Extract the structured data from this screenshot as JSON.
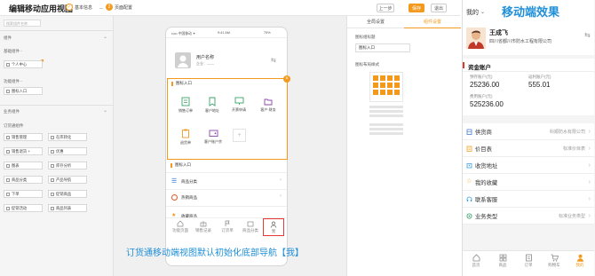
{
  "header": {
    "title": "编辑移动应用视图",
    "steps": [
      {
        "num": "✓",
        "label": "基本信息",
        "color": "#f39a1e"
      },
      {
        "num": "2",
        "label": "页面配置",
        "color": "#f39a1e"
      }
    ],
    "buttons": {
      "prev": "上一步",
      "save": "保存",
      "exit": "退出"
    }
  },
  "left_panel": {
    "search_placeholder": "搜索组件名称",
    "sections": [
      {
        "title": "组件",
        "items": []
      },
      {
        "title": "基础组件 -",
        "items": [
          "个人中心"
        ]
      },
      {
        "title": "功能组件 -",
        "items": [
          "图标入口"
        ]
      },
      {
        "title": "业务组件",
        "items": []
      }
    ],
    "business_sub": "订货通组件",
    "grid": [
      [
        "销售管理",
        "在库转化"
      ],
      [
        "销售退货 +",
        "优惠"
      ],
      [
        "图表",
        "库存分析"
      ],
      [
        "商品分类",
        "产品导航"
      ],
      [
        "下单",
        "促销商品"
      ],
      [
        "促销活动",
        "商品列表"
      ]
    ]
  },
  "phone": {
    "status": {
      "carrier": "••••• 中国移动 ✦",
      "time": "9:41 AM",
      "battery": "75%"
    },
    "user": {
      "name": "用户名称",
      "company": "企业：——"
    },
    "section1_title": "图标入口",
    "icons": [
      "销售订单",
      "客户地址",
      "开票申请",
      "客户·财务",
      "退货单",
      "客户账户余"
    ],
    "section2_title": "图标入口",
    "list": [
      "商品分类",
      "热销商品",
      "收藏商品"
    ],
    "tabs": [
      "功能页面",
      "销售记录",
      "订货单",
      "商品分类",
      "我"
    ]
  },
  "caption": "订货通移动端视图默认初始化底部导航【我】",
  "settings": {
    "tabs": [
      "全局设置",
      "组件设置"
    ],
    "label1": "图标组标题",
    "input1": "图标入口",
    "label2": "图标布局样式"
  },
  "preview": {
    "header_title": "我的",
    "overlay_title": "移动端效果",
    "user": {
      "name": "王成飞",
      "company": "四川省都川市防水工程有限公司"
    },
    "funds_title": "资金账户",
    "funds": [
      {
        "label": "预存账户(元)",
        "value": "25236.00"
      },
      {
        "label": "返利账户(元)",
        "value": "555.01"
      },
      {
        "label": "费用账户(元)",
        "value": "525236.00"
      }
    ],
    "list": [
      {
        "name": "供货商",
        "value": "科顺防水有限公司",
        "color": "#4a7fd6"
      },
      {
        "name": "价目表",
        "value": "标准价目表",
        "color": "#f0a020"
      },
      {
        "name": "收货地址",
        "value": "",
        "color": "#3aa0e0"
      },
      {
        "name": "我的收藏",
        "value": "",
        "color": "#f0a020"
      },
      {
        "name": "联系客服",
        "value": "",
        "color": "#3aa0e0"
      },
      {
        "name": "业务类型",
        "value": "标准业务类型",
        "color": "#2e9e60"
      }
    ],
    "tabs": [
      "首页",
      "商品",
      "订单",
      "购物车",
      "我的"
    ]
  },
  "colors": {
    "accent": "#f39a1e",
    "preview_header": "#d93a2b",
    "caption": "#1e8fd8",
    "highlight": "#e53935"
  }
}
